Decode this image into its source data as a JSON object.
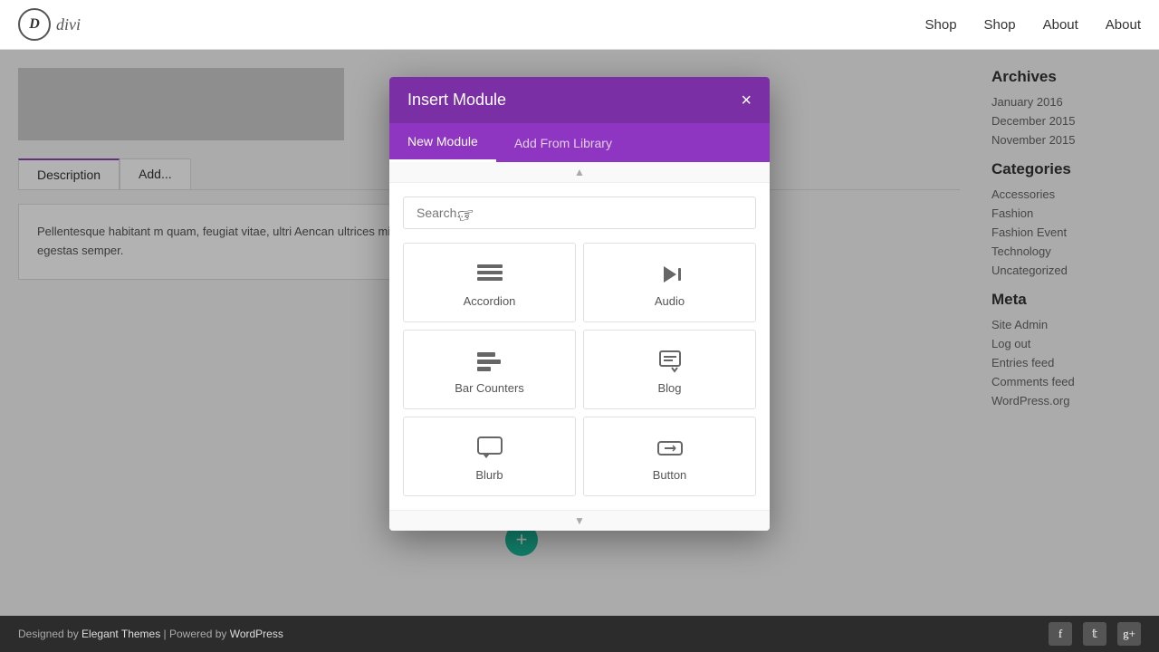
{
  "nav": {
    "logo_letter": "D",
    "logo_text": "divi",
    "links": [
      "Shop",
      "Shop",
      "About",
      "About"
    ]
  },
  "modal": {
    "title": "Insert Module",
    "close": "×",
    "tab_new": "New Module",
    "tab_library": "Add From Library",
    "search_placeholder": "Search...",
    "modules": [
      {
        "label": "Accordion",
        "icon": "≡"
      },
      {
        "label": "Audio",
        "icon": "◄"
      },
      {
        "label": "Bar Counters",
        "icon": "≡"
      },
      {
        "label": "Blog",
        "icon": "✎"
      },
      {
        "label": "Blurb",
        "icon": "💬"
      },
      {
        "label": "Button",
        "icon": "⊞"
      }
    ]
  },
  "page": {
    "tab_description": "Description",
    "tab_additional": "Add...",
    "content": "Pellentesque habitant m quam, feugiat vitae, ultri Aencan ultrices mi vitac",
    "content2": "egestas. Vestibulum tortor m egestas semper."
  },
  "sidebar": {
    "archives_title": "Categories",
    "categories": [
      "Accessories",
      "Fashion",
      "Fashion Event",
      "Technology",
      "Uncategorized"
    ],
    "meta_title": "Meta",
    "meta_links": [
      "Site Admin",
      "Log out",
      "Entries feed",
      "Comments feed",
      "WordPress.org"
    ],
    "dates": [
      "January 2016",
      "December 2015",
      "November 2015"
    ]
  },
  "footer": {
    "text": "Designed by Elegant Themes | Powered by WordPress"
  }
}
